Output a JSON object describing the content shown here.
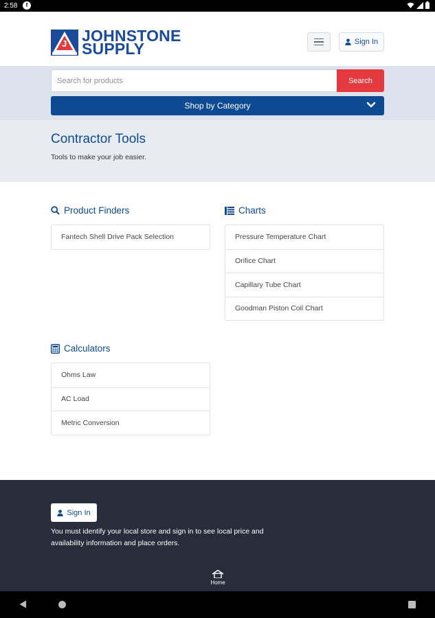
{
  "status_bar": {
    "time": "2:58",
    "app_icon_letter": "f"
  },
  "header": {
    "logo_line1": "JOHNSTONE",
    "logo_line2": "SUPPLY",
    "logo_mark_letter": "J",
    "sign_in_label": "Sign In"
  },
  "search": {
    "placeholder": "Search for products",
    "button_label": "Search",
    "category_label": "Shop by Category"
  },
  "hero": {
    "title": "Contractor Tools",
    "subtitle": "Tools to make your job easier."
  },
  "sections": {
    "product_finders": {
      "title": "Product Finders",
      "items": [
        "Fantech Shell Drive Pack Selection"
      ]
    },
    "charts": {
      "title": "Charts",
      "items": [
        "Pressure Temperature Chart",
        "Orifice Chart",
        "Capillary Tube Chart",
        "Goodman Piston Coil Chart"
      ]
    },
    "calculators": {
      "title": "Calculators",
      "items": [
        "Ohms Law",
        "AC Load",
        "Metric Conversion"
      ]
    }
  },
  "footer": {
    "sign_in_label": "Sign In",
    "notice": "You must identify your local store and sign in to see local price and availability information and place orders.",
    "home_label": "Home"
  },
  "colors": {
    "brand_blue": "#0e4a94",
    "search_red": "#e4393e",
    "footer_bg": "#282d3c"
  }
}
